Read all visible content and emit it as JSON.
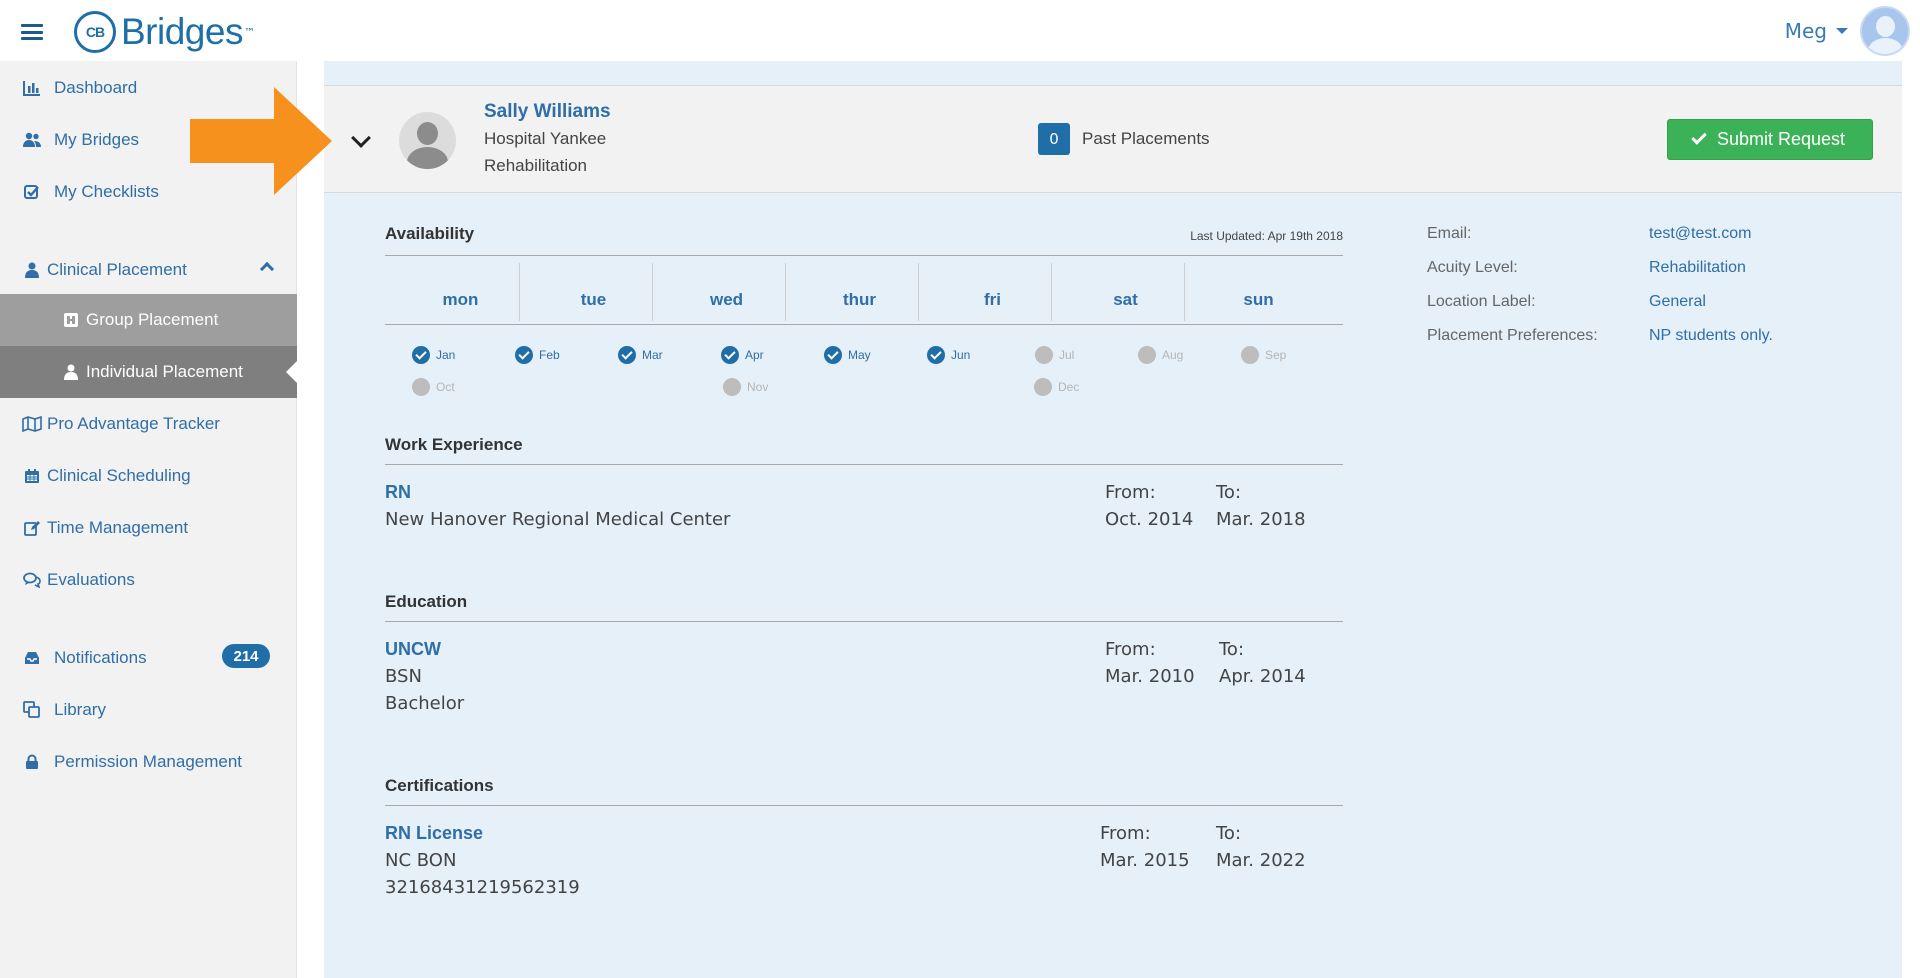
{
  "app": {
    "brand": "Bridges",
    "brand_badge": "CB",
    "brand_tm": "™"
  },
  "user": {
    "name": "Meg"
  },
  "sidebar": {
    "items": [
      {
        "label": "Dashboard",
        "icon": "bar-chart-icon"
      },
      {
        "label": "My Bridges",
        "icon": "users-icon"
      },
      {
        "label": "My Checklists",
        "icon": "checkbox-icon"
      },
      {
        "label": "Clinical Placement",
        "icon": "user-icon"
      },
      {
        "label": "Group Placement",
        "icon": "group-box-icon"
      },
      {
        "label": "Individual Placement",
        "icon": "user-icon"
      },
      {
        "label": "Pro Advantage Tracker",
        "icon": "map-icon"
      },
      {
        "label": "Clinical Scheduling",
        "icon": "calendar-icon"
      },
      {
        "label": "Time Management",
        "icon": "edit-icon"
      },
      {
        "label": "Evaluations",
        "icon": "comments-icon"
      },
      {
        "label": "Notifications",
        "icon": "inbox-icon",
        "badge": "214"
      },
      {
        "label": "Library",
        "icon": "copy-icon"
      },
      {
        "label": "Permission Management",
        "icon": "lock-icon"
      }
    ]
  },
  "profile": {
    "name": "Sally Williams",
    "line1": "Hospital Yankee",
    "line2": "Rehabilitation",
    "past_count": "0",
    "past_label": "Past Placements",
    "submit_label": "Submit Request"
  },
  "availability": {
    "title": "Availability",
    "last_updated": "Last Updated: Apr 19th 2018",
    "days": [
      "mon",
      "tue",
      "wed",
      "thur",
      "fri",
      "sat",
      "sun"
    ],
    "months": [
      {
        "label": "Jan",
        "on": true
      },
      {
        "label": "Feb",
        "on": true
      },
      {
        "label": "Mar",
        "on": true
      },
      {
        "label": "Apr",
        "on": true
      },
      {
        "label": "May",
        "on": true
      },
      {
        "label": "Jun",
        "on": true
      },
      {
        "label": "Jul",
        "on": false
      },
      {
        "label": "Aug",
        "on": false
      },
      {
        "label": "Sep",
        "on": false
      },
      {
        "label": "Oct",
        "on": false
      },
      {
        "label": "Nov",
        "on": false
      },
      {
        "label": "Dec",
        "on": false
      }
    ]
  },
  "work": {
    "title": "Work Experience",
    "role": "RN",
    "org": "New Hanover Regional Medical Center",
    "from_label": "From:",
    "from": "Oct. 2014",
    "to_label": "To:",
    "to": "Mar. 2018"
  },
  "education": {
    "title": "Education",
    "school": "UNCW",
    "degree": "BSN",
    "level": "Bachelor",
    "from_label": "From:",
    "from": "Mar. 2010",
    "to_label": "To:",
    "to": "Apr. 2014"
  },
  "certifications": {
    "title": "Certifications",
    "name": "RN License",
    "issuer": "NC BON",
    "number": "32168431219562319",
    "from_label": "From:",
    "from": "Mar. 2015",
    "to_label": "To:",
    "to": "Mar. 2022"
  },
  "info": [
    {
      "label": "Email:",
      "value": "test@test.com"
    },
    {
      "label": "Acuity Level:",
      "value": "Rehabilitation"
    },
    {
      "label": "Location Label:",
      "value": "General"
    },
    {
      "label": "Placement Preferences:",
      "value": "NP students only."
    }
  ],
  "colors": {
    "brand": "#1e6fa8",
    "submit": "#3bb257",
    "callout": "#f6911e",
    "panel": "#e6f0f9"
  }
}
